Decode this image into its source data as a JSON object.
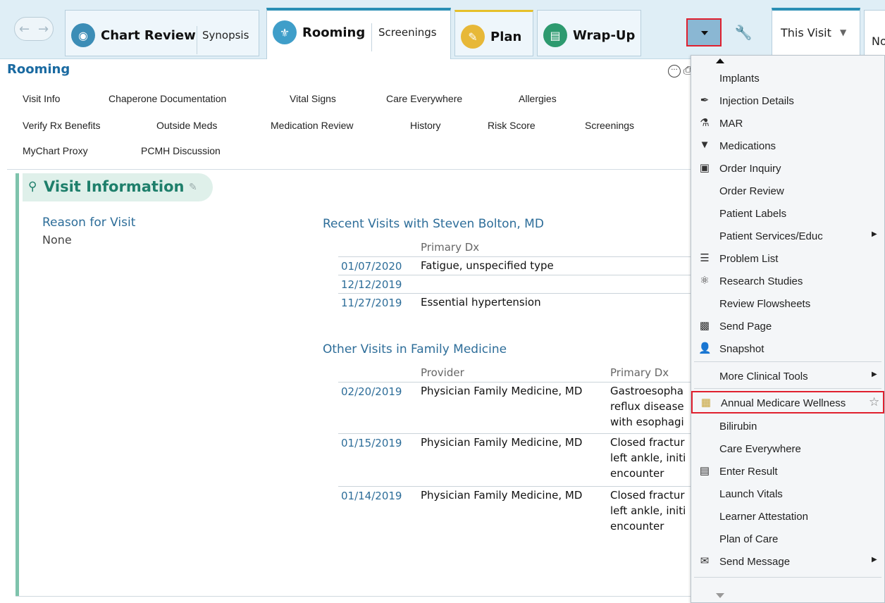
{
  "topbar": {
    "tabs": {
      "chart_review": "Chart Review",
      "synopsis": "Synopsis",
      "rooming": "Rooming",
      "screenings": "Screenings",
      "plan": "Plan",
      "wrap_up": "Wrap-Up"
    },
    "this_visit": "This Visit",
    "next_tab": "No",
    "icons": {
      "chart_review": "magnifier-chart-icon",
      "rooming": "stethoscope-icon",
      "plan": "clipboard-icon",
      "wrap_up": "wrap-up-icon",
      "wrench": "wrench-icon"
    }
  },
  "rooming": {
    "title": "Rooming",
    "links": [
      "Visit Info",
      "Chaperone Documentation",
      "Vital Signs",
      "Care Everywhere",
      "Allergies",
      "Verify Rx Benefits",
      "Outside Meds",
      "Medication Review",
      "History",
      "Risk Score",
      "Screenings",
      "MyChart Proxy",
      "PCMH Discussion"
    ]
  },
  "visit_info": {
    "title": "Visit Information",
    "reason_label": "Reason for Visit",
    "reason_value": "None",
    "recent": {
      "title": "Recent Visits with Steven Bolton, MD",
      "col_dx": "Primary Dx",
      "rows": [
        {
          "date": "01/07/2020",
          "dx": "Fatigue, unspecified type"
        },
        {
          "date": "12/12/2019",
          "dx": ""
        },
        {
          "date": "11/27/2019",
          "dx": "Essential hypertension"
        }
      ]
    },
    "other": {
      "title": "Other Visits in Family Medicine",
      "col_provider": "Provider",
      "col_dx": "Primary Dx",
      "rows": [
        {
          "date": "02/20/2019",
          "provider": "Physician Family Medicine, MD",
          "dx1": "Gastroesopha",
          "dx2": "reflux disease",
          "dx3": "with esophagi"
        },
        {
          "date": "01/15/2019",
          "provider": "Physician Family Medicine, MD",
          "dx1": "Closed fractur",
          "dx2": "left ankle, initi",
          "dx3": "encounter"
        },
        {
          "date": "01/14/2019",
          "provider": "Physician Family Medicine, MD",
          "dx1": "Closed fractur",
          "dx2": "left ankle, initi",
          "dx3": "encounter"
        }
      ]
    }
  },
  "menu": {
    "items": [
      {
        "label": "Implants",
        "icon": ""
      },
      {
        "label": "Injection Details",
        "icon": "syringe-icon"
      },
      {
        "label": "MAR",
        "icon": "mar-icon"
      },
      {
        "label": "Medications",
        "icon": "pill-bottle-icon"
      },
      {
        "label": "Order Inquiry",
        "icon": "order-inquiry-icon"
      },
      {
        "label": "Order Review",
        "icon": ""
      },
      {
        "label": "Patient Labels",
        "icon": ""
      },
      {
        "label": "Patient Services/Educ",
        "icon": "",
        "submenu": true
      },
      {
        "label": "Problem List",
        "icon": "problem-list-icon"
      },
      {
        "label": "Research Studies",
        "icon": "research-icon"
      },
      {
        "label": "Review Flowsheets",
        "icon": ""
      },
      {
        "label": "Send Page",
        "icon": "pager-icon"
      },
      {
        "label": "Snapshot",
        "icon": "person-icon"
      },
      {
        "label": "More Clinical Tools",
        "icon": "",
        "submenu": true
      },
      {
        "label": "Annual Medicare Wellness",
        "icon": "wellness-form-icon",
        "favorite": true
      },
      {
        "label": "Bilirubin",
        "icon": ""
      },
      {
        "label": "Care Everywhere",
        "icon": ""
      },
      {
        "label": "Enter Result",
        "icon": "enter-result-icon"
      },
      {
        "label": "Launch Vitals",
        "icon": ""
      },
      {
        "label": "Learner Attestation",
        "icon": ""
      },
      {
        "label": "Plan of Care",
        "icon": ""
      },
      {
        "label": "Send Message",
        "icon": "send-message-icon",
        "submenu": true
      }
    ]
  },
  "colors": {
    "accent": "#2a8fb5",
    "link": "#2d6d99",
    "section": "#1e7f6b",
    "highlight_border": "#e0202e"
  }
}
